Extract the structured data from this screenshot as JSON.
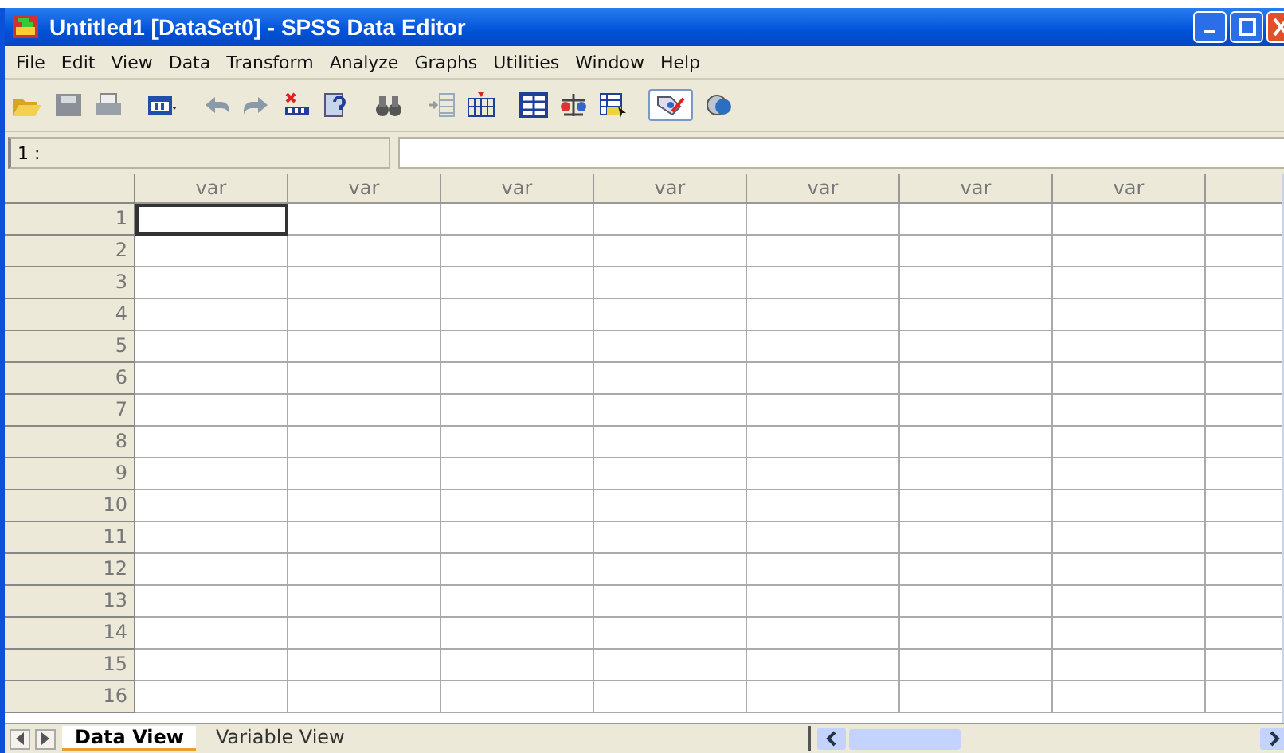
{
  "window": {
    "title": "Untitled1 [DataSet0] - SPSS Data Editor"
  },
  "menu": [
    "File",
    "Edit",
    "View",
    "Data",
    "Transform",
    "Analyze",
    "Graphs",
    "Utilities",
    "Window",
    "Help"
  ],
  "cell_editor": {
    "reference": "1 :"
  },
  "columns": [
    {
      "label": "var"
    },
    {
      "label": "var"
    },
    {
      "label": "var"
    },
    {
      "label": "var"
    },
    {
      "label": "var"
    },
    {
      "label": "var"
    },
    {
      "label": "var"
    }
  ],
  "rows": [
    {
      "label": "1",
      "selected": true
    },
    {
      "label": "2",
      "selected": false
    },
    {
      "label": "3",
      "selected": false
    },
    {
      "label": "4",
      "selected": false
    },
    {
      "label": "5",
      "selected": false
    },
    {
      "label": "6",
      "selected": false
    },
    {
      "label": "7",
      "selected": false
    },
    {
      "label": "8",
      "selected": false
    },
    {
      "label": "9",
      "selected": false
    },
    {
      "label": "10",
      "selected": false
    },
    {
      "label": "11",
      "selected": false
    },
    {
      "label": "12",
      "selected": false
    },
    {
      "label": "13",
      "selected": false
    },
    {
      "label": "14",
      "selected": false
    },
    {
      "label": "15",
      "selected": false
    },
    {
      "label": "16",
      "selected": false
    }
  ],
  "tabs": [
    {
      "label": "Data View",
      "selected": true
    },
    {
      "label": "Variable View",
      "selected": false
    }
  ]
}
